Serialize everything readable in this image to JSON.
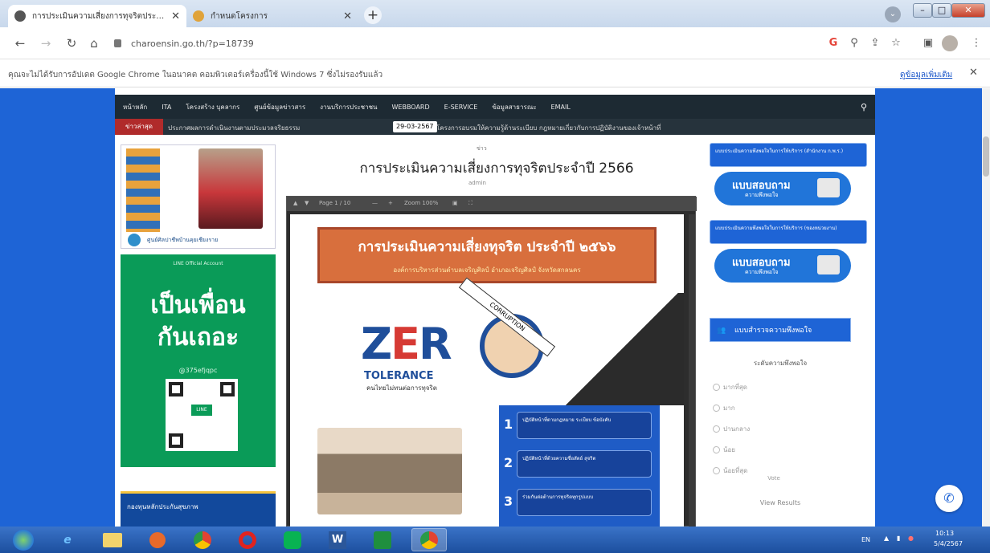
{
  "tabs": [
    {
      "title": "การประเมินความเสี่ยงการทุจริตประจำปี",
      "active": true
    },
    {
      "title": "กำหนดโครงการ",
      "active": false
    }
  ],
  "address": {
    "url": "charoensin.go.th/?p=18739"
  },
  "infobar": {
    "message": "คุณจะไม่ได้รับการอัปเดต Google Chrome ในอนาคต คอมพิวเตอร์เครื่องนี้ใช้ Windows 7 ซึ่งไม่รองรับแล้ว",
    "link": "ดูข้อมูลเพิ่มเติม"
  },
  "site": {
    "nav": [
      "หน้าหลัก",
      "ITA",
      "โครงสร้าง บุคลากร",
      "ศูนย์ข้อมูลข่าวสาร",
      "งานบริการประชาชน",
      "WEBBOARD",
      "E-SERVICE",
      "ข้อมูลสาธารณะ",
      "EMAIL"
    ],
    "ticker": {
      "label": "ข่าวล่าสุด",
      "text1": "ประกาศผลการดำเนินงานตามประมวลจริยธรรม",
      "date": "29-03-2567",
      "text2": "โครงการอบรมให้ความรู้ด้านระเบียบ กฎหมายเกี่ยวกับการปฏิบัติงานของเจ้าหน้าที่"
    },
    "profile_name": "ศูนย์ศิลปาชีพบ้านคุยเชียงราย",
    "line_ad": {
      "top": "LINE Official Account",
      "big_line1": "เป็นเพื่อน",
      "big_line2": "กันเถอะ",
      "id": "@375efjqpc",
      "qr_label": "LINE"
    },
    "badge2": "กองทุนหลักประกันสุขภาพ",
    "post": {
      "category": "ข่าว",
      "title": "การประเมินความเสี่ยงการทุจริตประจำปี 2566",
      "meta": "admin"
    },
    "pdf": {
      "toolbar_page": "Page 1 / 10",
      "toolbar_zoom": "Zoom 100%",
      "banner_title": "การประเมินความเสี่ยงทุจริต ประจำปี ๒๕๖๖",
      "banner_sub": "องค์การบริหารส่วนตำบลเจริญศิลป์ อำเภอเจริญศิลป์ จังหวัดสกลนคร",
      "zero_a": "Z",
      "zero_e": "E",
      "zero_b": "R",
      "zero_c": "O",
      "tolerance": "TOLERANCE",
      "tolerance_sub": "คนไทยไม่ทนต่อการทุจริต",
      "corruption": "CORRUPTION",
      "steps": [
        "ปฏิบัติหน้าที่ตามกฎหมาย ระเบียบ ข้อบังคับ",
        "ปฏิบัติหน้าที่ด้วยความซื่อสัตย์ สุจริต",
        "ร่วมกันต่อต้านการทุจริตทุกรูปแบบ"
      ]
    },
    "right": {
      "survey1_title": "แบบประเมินความพึงพอใจในการให้บริการ (สำนักงาน ก.พ.ร.)",
      "survey2_title": "แบบประเมินความพึงพอใจในการให้บริการ (ของหน่วยงาน)",
      "survey_l1": "แบบสอบถาม",
      "survey_l2": "ความพึงพอใจ",
      "poll_head": "แบบสำรวจความพึงพอใจ",
      "poll_q": "ระดับความพึงพอใจ",
      "options": [
        "มากที่สุด",
        "มาก",
        "ปานกลาง",
        "น้อย",
        "น้อยที่สุด"
      ],
      "vote": "Vote",
      "results": "View Results"
    }
  },
  "taskbar": {
    "lang": "EN",
    "time": "10:13",
    "date": "5/4/2567"
  },
  "colors": {
    "page_bg": "#1e64d6",
    "nav_bg": "#1d2a33",
    "line_green": "#0a9b58"
  },
  "icons": [
    "back-icon",
    "forward-icon",
    "reload-icon",
    "home-icon",
    "lock-icon",
    "google-icon",
    "zoom-icon",
    "share-icon",
    "star-icon",
    "sidepanel-icon",
    "menu-icon",
    "messenger-icon"
  ]
}
